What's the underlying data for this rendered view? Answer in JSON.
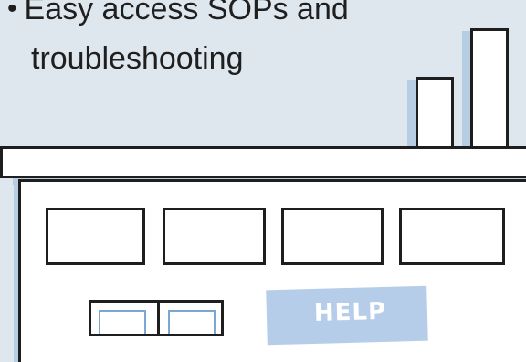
{
  "bullet": {
    "marker": "•",
    "line1": "Easy access SOPs and",
    "line2": "troubleshooting"
  },
  "illustration": {
    "sign_text": "HELP"
  },
  "colors": {
    "background": "#dfe7ee",
    "accent": "#3a77b5",
    "shadow": "#b7cde4",
    "sign": "#b5cde8",
    "outline": "#1e1e1e"
  }
}
